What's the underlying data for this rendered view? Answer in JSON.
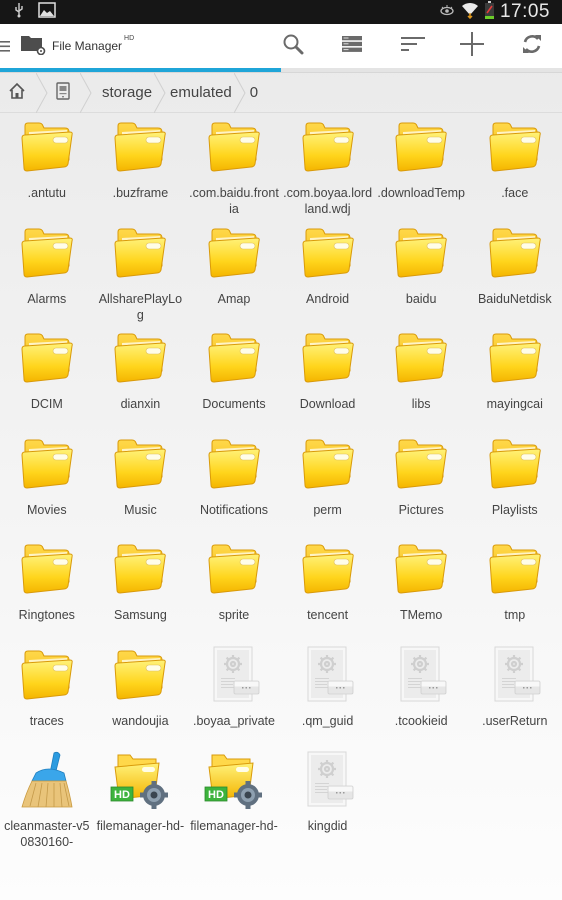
{
  "status_bar": {
    "icons_left": [
      "usb-icon",
      "image-icon"
    ],
    "icons_right": [
      "eye-icon",
      "wifi-icon",
      "battery-charging-icon"
    ],
    "time": "17:05"
  },
  "action_bar": {
    "menu_icon": "hamburger-icon",
    "app_icon": "folder-gear-icon",
    "app_name": "File Manager",
    "app_name_suffix": "HD",
    "actions": [
      {
        "name": "search",
        "icon": "search-icon"
      },
      {
        "name": "view-mode",
        "icon": "list-view-icon"
      },
      {
        "name": "sort",
        "icon": "sort-icon"
      },
      {
        "name": "add",
        "icon": "plus-icon"
      },
      {
        "name": "refresh",
        "icon": "refresh-icon"
      }
    ]
  },
  "progress": {
    "value_percent": 50,
    "color": "#1fa5d8"
  },
  "breadcrumb": {
    "home_icon": "home-icon",
    "device_icon": "device-storage-icon",
    "segments": [
      "storage",
      "emulated",
      "0"
    ]
  },
  "files": [
    {
      "name": ".antutu",
      "type": "folder"
    },
    {
      "name": ".buzframe",
      "type": "folder"
    },
    {
      "name": ".com.baidu.frontia",
      "type": "folder"
    },
    {
      "name": ".com.boyaa.lordland.wdj",
      "type": "folder"
    },
    {
      "name": ".downloadTemp",
      "type": "folder"
    },
    {
      "name": ".face",
      "type": "folder"
    },
    {
      "name": "Alarms",
      "type": "folder"
    },
    {
      "name": "AllsharePlayLog",
      "type": "folder"
    },
    {
      "name": "Amap",
      "type": "folder"
    },
    {
      "name": "Android",
      "type": "folder"
    },
    {
      "name": "baidu",
      "type": "folder"
    },
    {
      "name": "BaiduNetdisk",
      "type": "folder"
    },
    {
      "name": "DCIM",
      "type": "folder"
    },
    {
      "name": "dianxin",
      "type": "folder"
    },
    {
      "name": "Documents",
      "type": "folder"
    },
    {
      "name": "Download",
      "type": "folder"
    },
    {
      "name": "libs",
      "type": "folder"
    },
    {
      "name": "mayingcai",
      "type": "folder"
    },
    {
      "name": "Movies",
      "type": "folder"
    },
    {
      "name": "Music",
      "type": "folder"
    },
    {
      "name": "Notifications",
      "type": "folder"
    },
    {
      "name": "perm",
      "type": "folder"
    },
    {
      "name": "Pictures",
      "type": "folder"
    },
    {
      "name": "Playlists",
      "type": "folder"
    },
    {
      "name": "Ringtones",
      "type": "folder"
    },
    {
      "name": "Samsung",
      "type": "folder"
    },
    {
      "name": "sprite",
      "type": "folder"
    },
    {
      "name": "tencent",
      "type": "folder"
    },
    {
      "name": "TMemo",
      "type": "folder"
    },
    {
      "name": "tmp",
      "type": "folder"
    },
    {
      "name": "traces",
      "type": "folder"
    },
    {
      "name": "wandoujia",
      "type": "folder"
    },
    {
      "name": ".boyaa_private",
      "type": "file"
    },
    {
      "name": ".qm_guid",
      "type": "file"
    },
    {
      "name": ".tcookieid",
      "type": "file"
    },
    {
      "name": ".userReturn",
      "type": "file"
    },
    {
      "name": "cleanmaster-v50830160-",
      "type": "apk-cleanmaster"
    },
    {
      "name": "filemanager-hd-",
      "type": "apk-filemanager"
    },
    {
      "name": "filemanager-hd-",
      "type": "apk-filemanager"
    },
    {
      "name": "kingdid",
      "type": "file"
    }
  ]
}
